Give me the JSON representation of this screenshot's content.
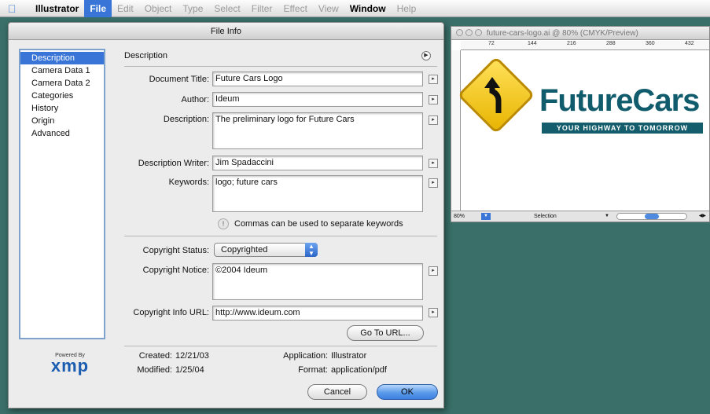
{
  "menubar": {
    "app_name": "Illustrator",
    "items": [
      "File",
      "Edit",
      "Object",
      "Type",
      "Select",
      "Filter",
      "Effect",
      "View",
      "Window",
      "Help"
    ]
  },
  "dialog": {
    "title": "File Info",
    "sidebar": [
      "Description",
      "Camera Data 1",
      "Camera Data 2",
      "Categories",
      "History",
      "Origin",
      "Advanced"
    ],
    "section_header": "Description",
    "fields": {
      "document_title": {
        "label": "Document Title:",
        "value": "Future Cars Logo"
      },
      "author": {
        "label": "Author:",
        "value": "Ideum"
      },
      "description": {
        "label": "Description:",
        "value": "The preliminary logo for Future Cars"
      },
      "description_writer": {
        "label": "Description Writer:",
        "value": "Jim Spadaccini"
      },
      "keywords": {
        "label": "Keywords:",
        "value": "logo; future cars"
      },
      "keywords_note": "Commas can be used to separate keywords",
      "copyright_status": {
        "label": "Copyright Status:",
        "value": "Copyrighted"
      },
      "copyright_notice": {
        "label": "Copyright Notice:",
        "value": "©2004 Ideum"
      },
      "copyright_url": {
        "label": "Copyright Info URL:",
        "value": "http://www.ideum.com"
      }
    },
    "go_to_url_label": "Go To URL...",
    "xmp": {
      "powered_by": "Powered By",
      "brand": "xmp"
    },
    "meta": {
      "created_label": "Created:",
      "created": "12/21/03",
      "modified_label": "Modified:",
      "modified": "1/25/04",
      "application_label": "Application:",
      "application": "Illustrator",
      "format_label": "Format:",
      "format": "application/pdf"
    },
    "cancel_label": "Cancel",
    "ok_label": "OK"
  },
  "document": {
    "title": "future-cars-logo.ai @ 80% (CMYK/Preview)",
    "ruler_marks": [
      "72",
      "144",
      "216",
      "288",
      "360",
      "432"
    ],
    "zoom": "80%",
    "status_tool": "Selection",
    "logo_text": "FutureCars",
    "logo_tagline": "YOUR HIGHWAY TO TOMORROW"
  },
  "colors": {
    "desktop": "#3a6e68",
    "accent": "#3875d7",
    "logo_teal": "#115c6c",
    "sign_yellow": "#f4c600"
  }
}
